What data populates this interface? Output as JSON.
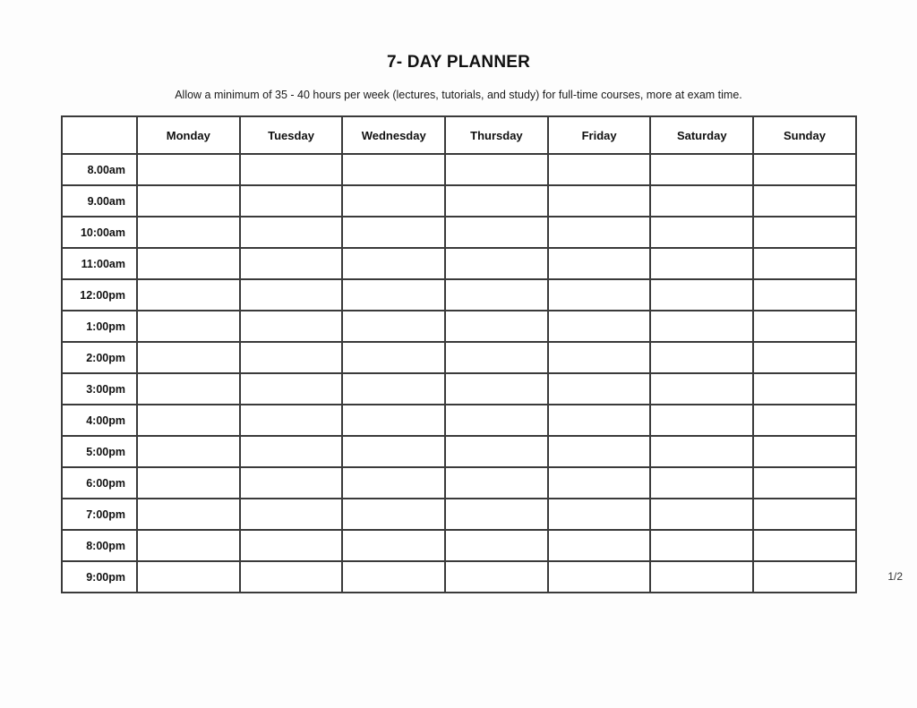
{
  "document": {
    "title": "7- DAY PLANNER",
    "subtitle": "Allow a minimum of 35 - 40 hours per week (lectures, tutorials, and study) for full-time courses, more at exam time.",
    "page_indicator": "1/2"
  },
  "colors": {
    "page_background": "#fdfdfd",
    "cell_background": "#ffffff",
    "border": "#3a3a3a",
    "text": "#111111"
  },
  "table": {
    "corner_header": "",
    "day_headers": [
      "Monday",
      "Tuesday",
      "Wednesday",
      "Thursday",
      "Friday",
      "Saturday",
      "Sunday"
    ],
    "time_labels": [
      "8.00am",
      "9.00am",
      "10:00am",
      "11:00am",
      "12:00pm",
      "1:00pm",
      "2:00pm",
      "3:00pm",
      "4:00pm",
      "5:00pm",
      "6:00pm",
      "7:00pm",
      "8:00pm",
      "9:00pm"
    ],
    "rows": [
      {
        "time": "8.00am",
        "cells": [
          "",
          "",
          "",
          "",
          "",
          "",
          ""
        ]
      },
      {
        "time": "9.00am",
        "cells": [
          "",
          "",
          "",
          "",
          "",
          "",
          ""
        ]
      },
      {
        "time": "10:00am",
        "cells": [
          "",
          "",
          "",
          "",
          "",
          "",
          ""
        ]
      },
      {
        "time": "11:00am",
        "cells": [
          "",
          "",
          "",
          "",
          "",
          "",
          ""
        ]
      },
      {
        "time": "12:00pm",
        "cells": [
          "",
          "",
          "",
          "",
          "",
          "",
          ""
        ]
      },
      {
        "time": "1:00pm",
        "cells": [
          "",
          "",
          "",
          "",
          "",
          "",
          ""
        ]
      },
      {
        "time": "2:00pm",
        "cells": [
          "",
          "",
          "",
          "",
          "",
          "",
          ""
        ]
      },
      {
        "time": "3:00pm",
        "cells": [
          "",
          "",
          "",
          "",
          "",
          "",
          ""
        ]
      },
      {
        "time": "4:00pm",
        "cells": [
          "",
          "",
          "",
          "",
          "",
          "",
          ""
        ]
      },
      {
        "time": "5:00pm",
        "cells": [
          "",
          "",
          "",
          "",
          "",
          "",
          ""
        ]
      },
      {
        "time": "6:00pm",
        "cells": [
          "",
          "",
          "",
          "",
          "",
          "",
          ""
        ]
      },
      {
        "time": "7:00pm",
        "cells": [
          "",
          "",
          "",
          "",
          "",
          "",
          ""
        ]
      },
      {
        "time": "8:00pm",
        "cells": [
          "",
          "",
          "",
          "",
          "",
          "",
          ""
        ]
      },
      {
        "time": "9:00pm",
        "cells": [
          "",
          "",
          "",
          "",
          "",
          "",
          ""
        ]
      }
    ]
  }
}
